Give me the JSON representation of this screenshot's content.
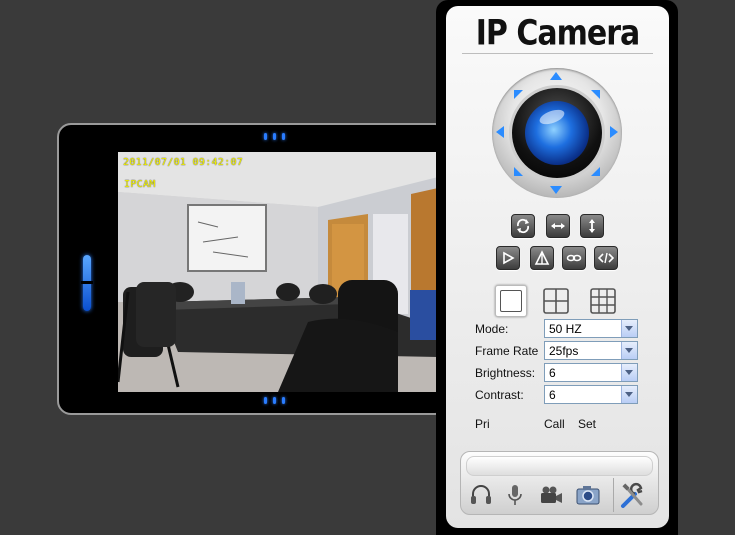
{
  "brand": {
    "title": "IP Camera"
  },
  "video": {
    "timestamp": "2011/07/01 09:42:07",
    "camera_name": "IPCAM"
  },
  "settings": {
    "mode": {
      "label": "Mode:",
      "value": "50 HZ"
    },
    "frame_rate": {
      "label": "Frame Rate",
      "value": "25fps"
    },
    "brightness": {
      "label": "Brightness:",
      "value": "6"
    },
    "contrast": {
      "label": "Contrast:",
      "value": "6"
    }
  },
  "preset": {
    "pri": "Pri",
    "call": "Call",
    "set": "Set"
  },
  "icons": {
    "ptz": [
      "arrow-up-icon",
      "arrow-down-icon",
      "arrow-left-icon",
      "arrow-right-icon",
      "arrow-up-left-icon",
      "arrow-up-right-icon",
      "arrow-down-left-icon",
      "arrow-down-right-icon"
    ],
    "controls": [
      "rotate-icon",
      "horizontal-patrol-icon",
      "vertical-patrol-icon",
      "play-icon",
      "flip-icon",
      "mirror-icon",
      "code-icon"
    ],
    "layouts": [
      "single-view-icon",
      "quad-view-icon",
      "nine-view-icon"
    ],
    "toolbar": [
      "headphone-icon",
      "microphone-icon",
      "video-record-icon",
      "snapshot-icon",
      "settings-tools-icon"
    ]
  },
  "colors": {
    "accent": "#2b8cff",
    "osd": "#f4f400",
    "background": "#3a3a3a"
  }
}
